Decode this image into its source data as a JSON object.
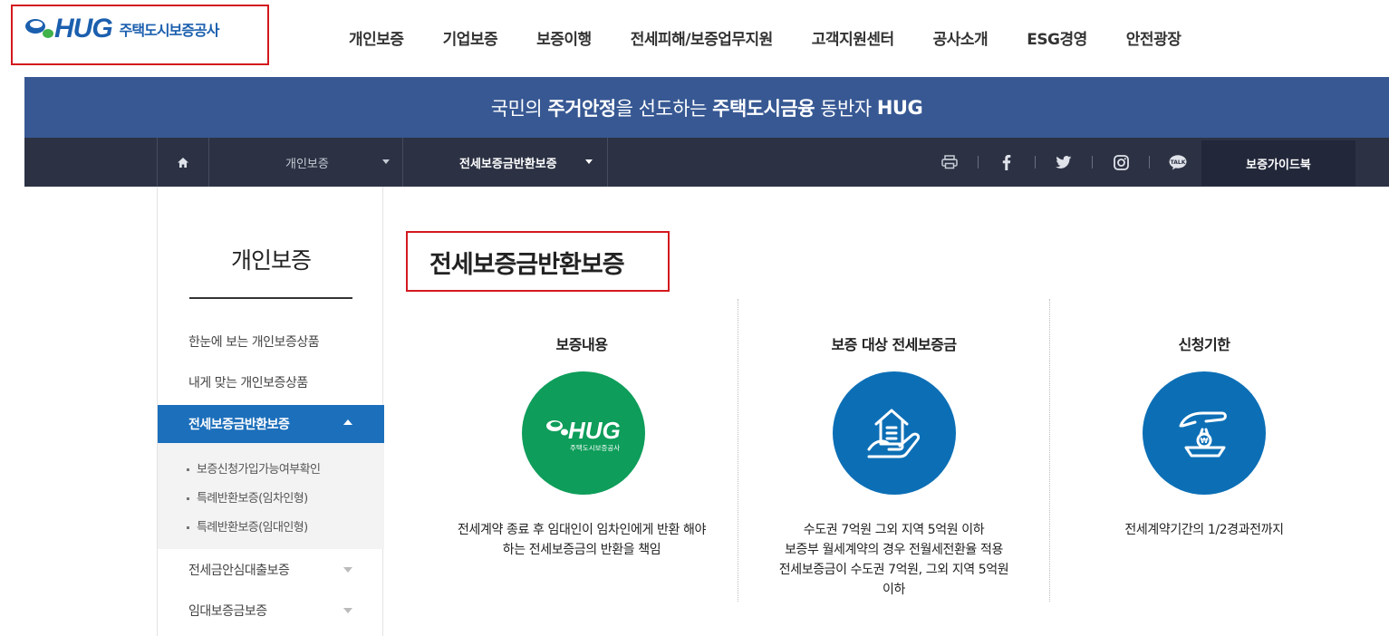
{
  "header": {
    "logo_text": "HUG",
    "logo_kr": "주택도시보증공사",
    "nav": [
      "개인보증",
      "기업보증",
      "보증이행",
      "전세피해/보증업무지원",
      "고객지원센터",
      "공사소개",
      "ESG경영",
      "안전광장"
    ]
  },
  "banner": {
    "p1": "국민의 ",
    "b1": "주거안정",
    "p2": "을 선도하는 ",
    "b2": "주택도시금융",
    "p3": " 동반자 ",
    "b3": "HUG"
  },
  "subnav": {
    "dropdown1": "개인보증",
    "dropdown2": "전세보증금반환보증",
    "guide_button": "보증가이드북",
    "icons": [
      "home-icon",
      "print-icon",
      "facebook-icon",
      "twitter-icon",
      "instagram-icon",
      "kakaotalk-icon"
    ]
  },
  "lnb": {
    "title": "개인보증",
    "items": [
      "한눈에 보는 개인보증상품",
      "내게 맞는 개인보증상품",
      "전세보증금반환보증",
      "전세금안심대출보증",
      "임대보증금보증"
    ],
    "subitems": [
      "보증신청가입가능여부확인",
      "특례반환보증(임차인형)",
      "특례반환보증(임대인형)"
    ]
  },
  "main": {
    "page_title": "전세보증금반환보증",
    "columns": [
      {
        "heading": "보증내용",
        "lines": [
          "전세계약 종료 후 임대인이 임차인에게 반환 해야",
          "하는 전세보증금의 반환을 책임"
        ],
        "circle_logo": "HUG",
        "circle_logo_kr": "주택도시보증공사"
      },
      {
        "heading": "보증 대상 전세보증금",
        "lines": [
          "수도권 7억원 그외 지역 5억원 이하",
          "보증부 월세계약의 경우 전월세전환율 적용",
          "전세보증금이 수도권 7억원, 그외 지역 5억원",
          "이하"
        ]
      },
      {
        "heading": "신청기한",
        "lines": [
          "전세계약기간의 1/2경과전까지"
        ]
      }
    ]
  },
  "colors": {
    "brand_blue": "#1b5fae",
    "banner": "#375893",
    "subnav": "#2c3244",
    "active": "#1c6fbb",
    "green": "#0e9d5a",
    "circle_blue": "#0c6fb6",
    "highlight": "#d3191e"
  }
}
